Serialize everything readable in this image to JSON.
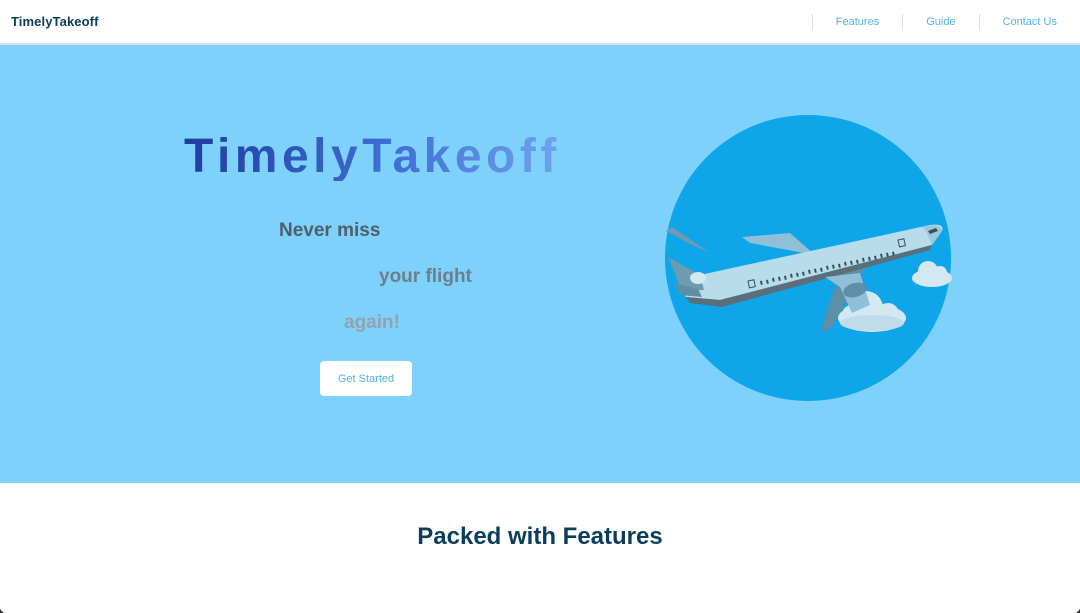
{
  "app": {
    "brand": "TimelyTakeoff"
  },
  "nav": {
    "items": [
      {
        "label": "Features"
      },
      {
        "label": "Guide"
      },
      {
        "label": "Contact Us"
      }
    ]
  },
  "hero": {
    "title": "TimelyTakeoff",
    "taglines": [
      "Never miss",
      "your flight",
      "again!"
    ],
    "cta_label": "Get Started",
    "illustration": "airplane-illustration",
    "colors": {
      "background": "#7dd1fb",
      "circle": "#0ea5e9",
      "accent": "#4fb3e0"
    }
  },
  "features": {
    "heading": "Packed with Features"
  }
}
